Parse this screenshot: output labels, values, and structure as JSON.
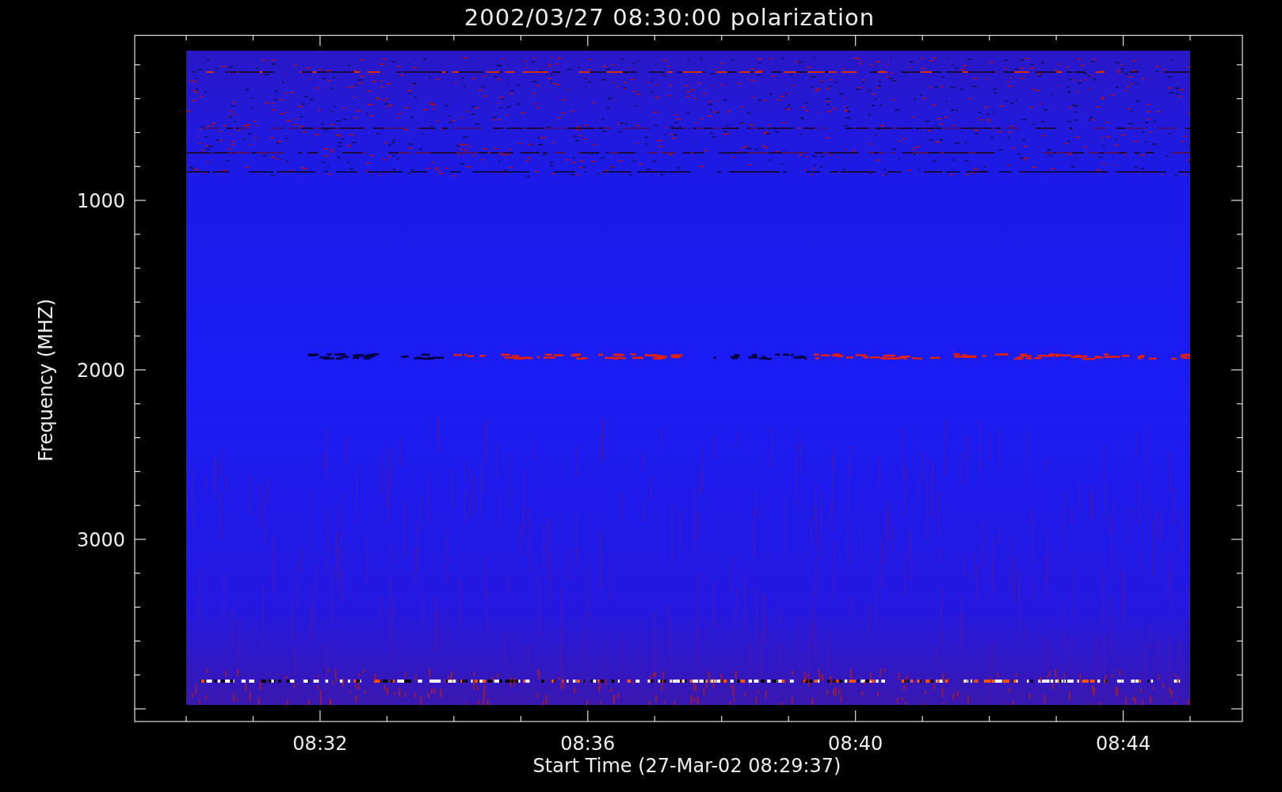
{
  "plot": {
    "title": "2002/03/27 08:30:00 polarization",
    "xlabel": "Start Time (27-Mar-02 08:29:37)",
    "ylabel": "Frequency (MHZ)",
    "x_tick_labels": [
      "08:32",
      "08:36",
      "08:40",
      "08:44"
    ],
    "y_tick_labels": [
      "1000",
      "2000",
      "3000"
    ]
  }
}
